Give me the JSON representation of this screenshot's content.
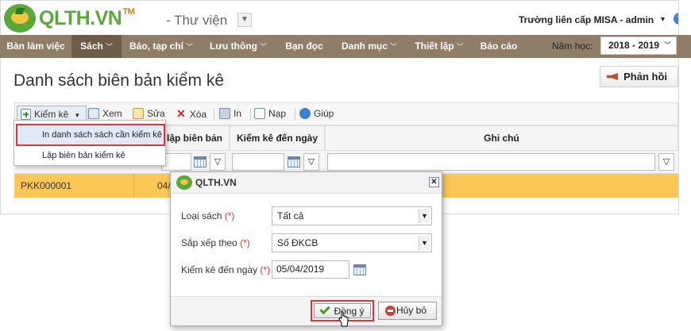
{
  "header": {
    "logo_text": "QLTH.VN",
    "logo_tm": "TM",
    "module": "- Thư viện",
    "school_user": "Trường liên cấp MISA - admin"
  },
  "menu": [
    {
      "label": "Bàn làm việc",
      "active": false,
      "caret": false
    },
    {
      "label": "Sách",
      "active": true,
      "caret": true
    },
    {
      "label": "Báo, tạp chí",
      "active": false,
      "caret": true
    },
    {
      "label": "Lưu thông",
      "active": false,
      "caret": true
    },
    {
      "label": "Bạn đọc",
      "active": false,
      "caret": false
    },
    {
      "label": "Danh mục",
      "active": false,
      "caret": true
    },
    {
      "label": "Thiết lập",
      "active": false,
      "caret": true
    },
    {
      "label": "Báo cáo",
      "active": false,
      "caret": false
    }
  ],
  "year": {
    "label": "Năm học:",
    "value": "2018 - 2019"
  },
  "page": {
    "title": "Danh sách biên bản kiểm kê",
    "feedback": "Phản hồi"
  },
  "toolbar": {
    "kiemke": "Kiểm kê",
    "xem": "Xem",
    "sua": "Sửa",
    "xoa": "Xóa",
    "in": "In",
    "nap": "Nạp",
    "giup": "Giúp"
  },
  "dropdown": {
    "item1": "In danh sách sách cần kiểm kê",
    "item2": "Lập biên bản kiểm kê"
  },
  "grid": {
    "col_lap": "lập biên bản",
    "col_kiemke": "Kiểm kê đến ngày",
    "col_ghichu": "Ghi chú",
    "row_code": "PKK000001",
    "row_date_part": "04/"
  },
  "dialog": {
    "title": "QLTH.VN",
    "loai_sach_label": "Loại sách",
    "loai_sach_value": "Tất cả",
    "sapxep_label": "Sắp xếp theo",
    "sapxep_value": "Số ĐKCB",
    "kiemke_label": "Kiểm kê đến ngày",
    "kiemke_value": "05/04/2019",
    "required_mark": "(*)",
    "ok": "Đồng ý",
    "cancel": "Hủy bỏ"
  }
}
